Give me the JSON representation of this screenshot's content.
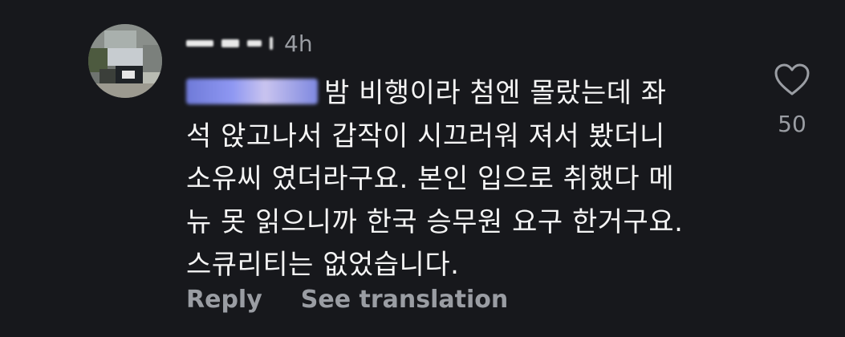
{
  "comment": {
    "timestamp": "4h",
    "lines": [
      "밤 비행이라 첨엔 몰랐는데 좌",
      "석 앉고나서 갑작이 시끄러워 져서 봤더니",
      "소유씨 였더라구요. 본인 입으로 취했다 메",
      "뉴 못 읽으니까 한국 승무원 요구 한거구요.",
      "스큐리티는 없었습니다."
    ],
    "like_count": "50",
    "like_icon": "heart-outline-icon"
  },
  "actions": {
    "reply_label": "Reply",
    "translate_label": "See translation"
  },
  "colors": {
    "background": "#17181c",
    "secondary_text": "#9a9da3",
    "mention": "#8e97f2"
  }
}
